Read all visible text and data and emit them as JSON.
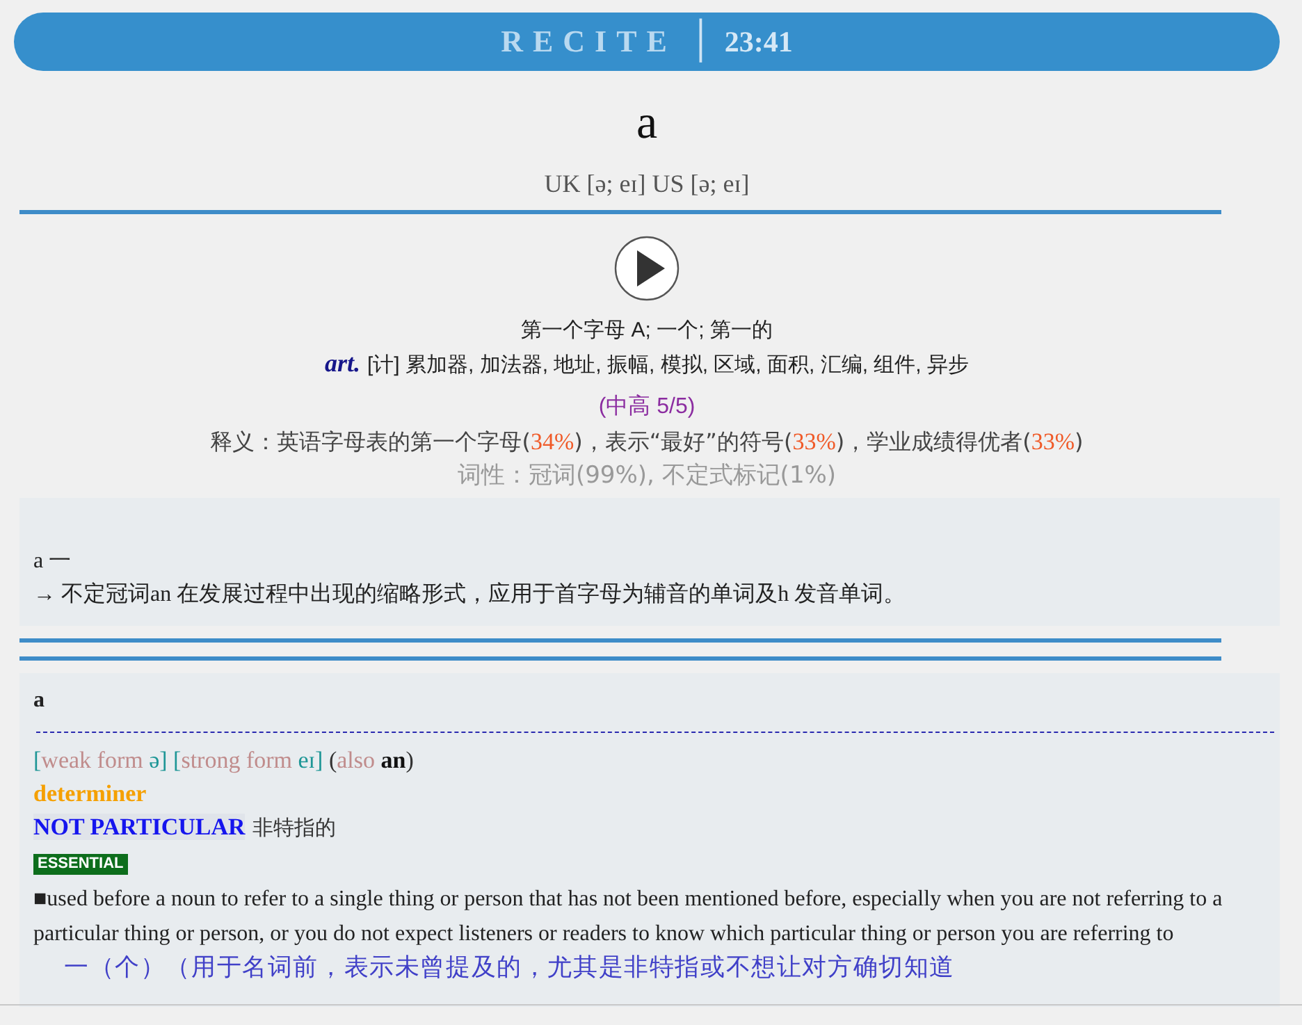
{
  "header": {
    "title": "RECITE",
    "separator": "│",
    "time": "23:41"
  },
  "word": "a",
  "phonetic": "UK [ə; eɪ] US [ə; eɪ]",
  "meanings": {
    "primary": "第一个字母 A; 一个; 第一的",
    "pos": "art.",
    "secondary": "[计] 累加器, 加法器, 地址, 振幅, 模拟, 区域, 面积, 汇编, 组件, 异步"
  },
  "frequency": "(中高 5/5)",
  "definition": [
    {
      "text": "释义：英语字母表的第一个字母(",
      "kind": "text"
    },
    {
      "text": "34%",
      "kind": "percent"
    },
    {
      "text": ")，表示“最好”的符号(",
      "kind": "text"
    },
    {
      "text": "33%",
      "kind": "percent"
    },
    {
      "text": ")，学业成绩得优者(",
      "kind": "text"
    },
    {
      "text": "33%",
      "kind": "percent"
    },
    {
      "text": ")",
      "kind": "text"
    }
  ],
  "pos_stats": "词性：冠词(99%), 不定式标记(1%)",
  "etymology": {
    "head": "a 一",
    "text": "→ 不定冠词an 在发展过程中出现的缩略形式，应用于首字母为辅音的单词及h 发音单词。"
  },
  "entry": {
    "headword": "a",
    "forms": [
      {
        "text": "[",
        "kind": "mark"
      },
      {
        "text": "weak form",
        "kind": "label"
      },
      {
        "text": " ə] [",
        "kind": "mark"
      },
      {
        "text": "strong form",
        "kind": "label"
      },
      {
        "text": " eɪ]",
        "kind": "mark"
      },
      {
        "text": " (",
        "kind": "plain"
      },
      {
        "text": "also",
        "kind": "label"
      },
      {
        "text": " an",
        "kind": "word"
      },
      {
        "text": ")",
        "kind": "plain"
      }
    ],
    "part_of_speech": "determiner",
    "signpost": "NOT PARTICULAR",
    "translation": "非特指的",
    "badge": "ESSENTIAL",
    "sense_definition": "■used before a noun to refer to a single thing or person that has not been mentioned before, especially when you are not referring to a particular thing or person, or you do not expect listeners or readers to know which particular thing or person you are referring to",
    "sense_translation": "一（个）（用于名词前，表示未曾提及的，尤其是非特指或不想让对方确切知道"
  }
}
